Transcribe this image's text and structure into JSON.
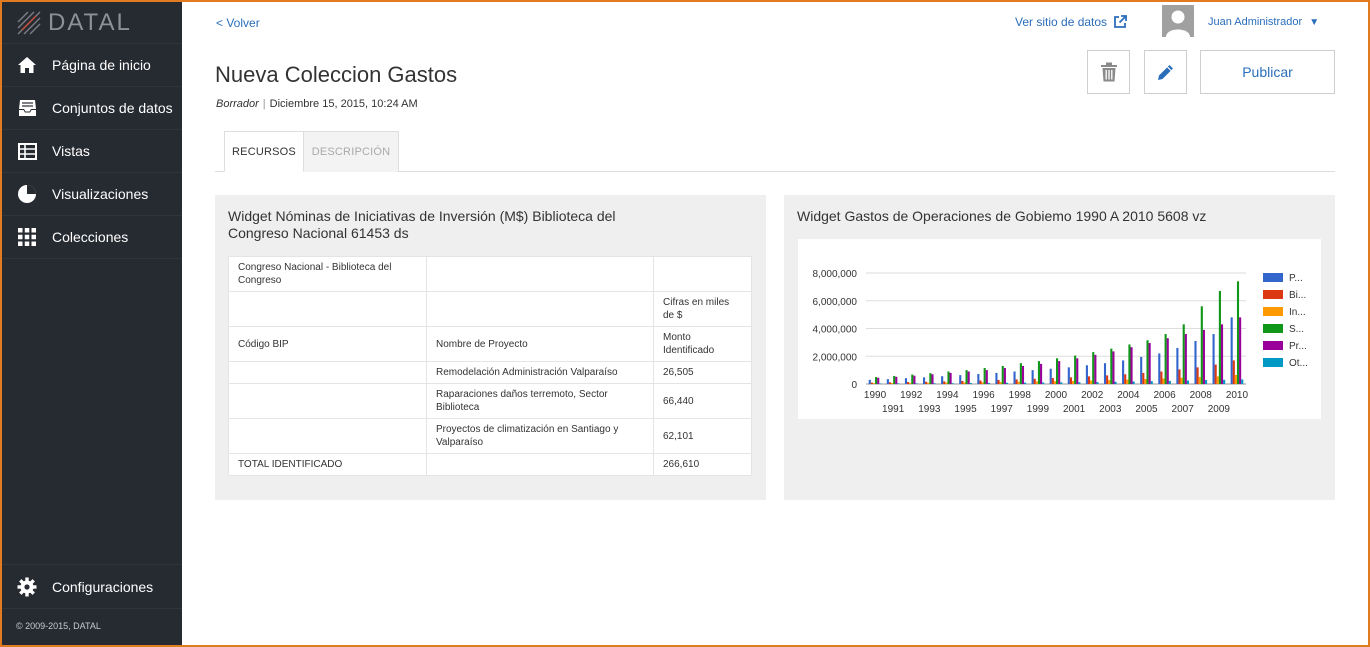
{
  "app": {
    "logo_text": "DATAL"
  },
  "sidebar": {
    "items": [
      {
        "label": "Página de inicio",
        "icon": "home-icon"
      },
      {
        "label": "Conjuntos de datos",
        "icon": "inbox-icon"
      },
      {
        "label": "Vistas",
        "icon": "table-icon"
      },
      {
        "label": "Visualizaciones",
        "icon": "pie-chart-icon"
      },
      {
        "label": "Colecciones",
        "icon": "grid-icon"
      }
    ],
    "settings_label": "Configuraciones",
    "copyright": "© 2009-2015, DATAL"
  },
  "header": {
    "back_label": "< Volver",
    "site_link_label": "Ver sitio de datos",
    "user_name": "Juan Administrador",
    "user_caret": "▼"
  },
  "page": {
    "title": "Nueva Coleccion Gastos",
    "status": "Borrador",
    "separator": "|",
    "date": "Diciembre 15, 2015, 10:24 AM",
    "publish_label": "Publicar"
  },
  "tabs": [
    {
      "label": "RECURSOS",
      "active": true
    },
    {
      "label": "DESCRIPCIÓN",
      "active": false
    }
  ],
  "widget_left": {
    "title": "Widget Nóminas de Iniciativas de Inversión (M$) Biblioteca del Congreso Nacional 61453 ds",
    "rows": [
      [
        "Congreso Nacional - Biblioteca del Congreso",
        "",
        ""
      ],
      [
        "",
        "",
        "Cifras en miles de $"
      ],
      [
        "Código BIP",
        "Nombre de Proyecto",
        "Monto Identificado"
      ],
      [
        "",
        "Remodelación Administración Valparaíso",
        "26,505"
      ],
      [
        "",
        "Raparaciones daños terremoto, Sector Biblioteca",
        "66,440"
      ],
      [
        "",
        "Proyectos de climatización en Santiago y Valparaíso",
        "62,101"
      ],
      [
        "TOTAL IDENTIFICADO",
        "",
        "266,610"
      ]
    ]
  },
  "widget_right": {
    "title": "Widget Gastos de Operaciones de Gobiemo 1990 A 2010 5608 vz"
  },
  "chart_data": {
    "type": "bar",
    "title": "",
    "xlabel": "",
    "ylabel": "",
    "ylim": [
      0,
      8000000
    ],
    "yticks": [
      "0",
      "2,000,000",
      "4,000,000",
      "6,000,000",
      "8,000,000"
    ],
    "categories": [
      "1990",
      "1991",
      "1992",
      "1993",
      "1994",
      "1995",
      "1996",
      "1997",
      "1998",
      "1999",
      "2000",
      "2001",
      "2002",
      "2003",
      "2004",
      "2005",
      "2006",
      "2007",
      "2008",
      "2009",
      "2010"
    ],
    "legend_position": "right",
    "series": [
      {
        "name": "P...",
        "color": "#3366cc",
        "values": [
          300000,
          350000,
          420000,
          480000,
          560000,
          640000,
          720000,
          800000,
          900000,
          1000000,
          1100000,
          1200000,
          1350000,
          1500000,
          1700000,
          1950000,
          2200000,
          2600000,
          3100000,
          3600000,
          4800000
        ]
      },
      {
        "name": "Bi...",
        "color": "#dc3912",
        "values": [
          100000,
          120000,
          140000,
          160000,
          190000,
          220000,
          250000,
          290000,
          330000,
          380000,
          430000,
          480000,
          550000,
          620000,
          700000,
          800000,
          900000,
          1050000,
          1200000,
          1400000,
          1700000
        ]
      },
      {
        "name": "In...",
        "color": "#ff9900",
        "values": [
          60000,
          70000,
          80000,
          90000,
          100000,
          110000,
          120000,
          140000,
          160000,
          180000,
          200000,
          220000,
          250000,
          280000,
          320000,
          360000,
          400000,
          450000,
          500000,
          550000,
          650000
        ]
      },
      {
        "name": "S...",
        "color": "#109618",
        "values": [
          500000,
          580000,
          680000,
          780000,
          900000,
          1000000,
          1150000,
          1300000,
          1500000,
          1650000,
          1850000,
          2050000,
          2300000,
          2550000,
          2850000,
          3150000,
          3600000,
          4300000,
          5600000,
          6700000,
          7400000
        ]
      },
      {
        "name": "Pr...",
        "color": "#990099",
        "values": [
          450000,
          520000,
          600000,
          700000,
          800000,
          900000,
          1000000,
          1150000,
          1300000,
          1450000,
          1650000,
          1850000,
          2100000,
          2350000,
          2650000,
          2950000,
          3300000,
          3600000,
          3900000,
          4300000,
          4800000
        ]
      },
      {
        "name": "Ot...",
        "color": "#0099c6",
        "values": [
          40000,
          45000,
          50000,
          55000,
          60000,
          70000,
          80000,
          90000,
          100000,
          110000,
          120000,
          130000,
          140000,
          160000,
          180000,
          200000,
          220000,
          250000,
          280000,
          300000,
          330000
        ]
      }
    ]
  }
}
